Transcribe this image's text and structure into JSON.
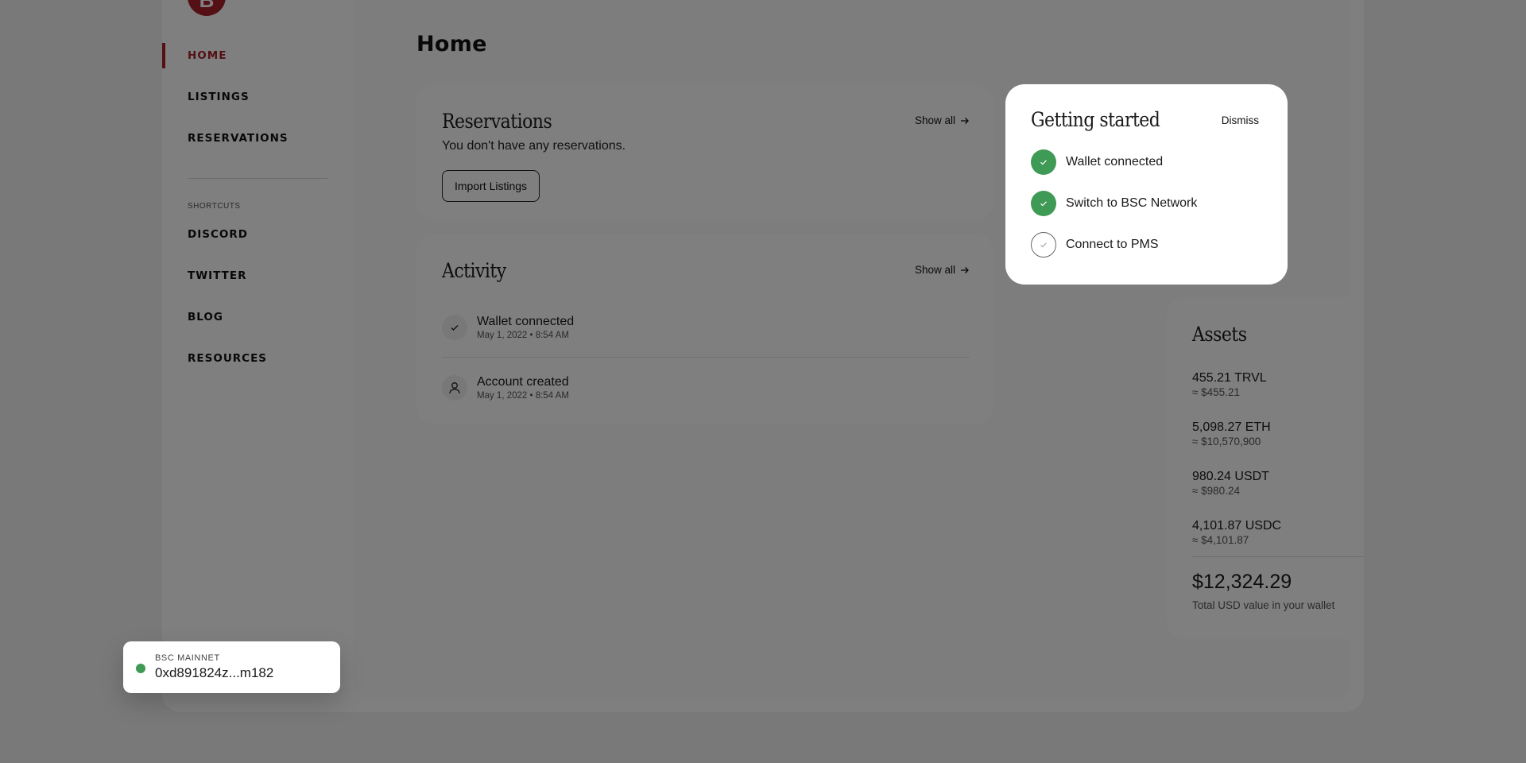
{
  "sidebar": {
    "logo_letter": "B",
    "nav": [
      {
        "label": "HOME",
        "active": true
      },
      {
        "label": "LISTINGS",
        "active": false
      },
      {
        "label": "RESERVATIONS",
        "active": false
      }
    ],
    "shortcuts_label": "SHORTCUTS",
    "shortcuts": [
      {
        "label": "DISCORD"
      },
      {
        "label": "TWITTER"
      },
      {
        "label": "BLOG"
      },
      {
        "label": "RESOURCES"
      }
    ]
  },
  "page": {
    "title": "Home"
  },
  "reservations": {
    "title": "Reservations",
    "show_all": "Show all",
    "empty_text": "You don't have any reservations.",
    "import_button": "Import Listings"
  },
  "activity": {
    "title": "Activity",
    "show_all": "Show all",
    "items": [
      {
        "icon": "check-icon",
        "title": "Wallet connected",
        "time": "May 1, 2022 • 8:54 AM"
      },
      {
        "icon": "user-icon",
        "title": "Account created",
        "time": "May 1, 2022 • 8:54 AM"
      }
    ]
  },
  "getting_started": {
    "title": "Getting started",
    "dismiss": "Dismiss",
    "steps": [
      {
        "label": "Wallet connected",
        "done": true
      },
      {
        "label": "Switch to BSC Network",
        "done": true
      },
      {
        "label": "Connect to PMS",
        "done": false
      }
    ]
  },
  "assets": {
    "title": "Assets",
    "items": [
      {
        "amount": "455.21 TRVL",
        "usd": "≈ $455.21",
        "icon": "trvl-coin-icon",
        "color": "#061621"
      },
      {
        "amount": "5,098.27 ETH",
        "usd": "≈ $10,570,900",
        "icon": "eth-coin-icon",
        "color": "#627eea"
      },
      {
        "amount": "980.24 USDT",
        "usd": "≈ $980.24",
        "icon": "usdt-coin-icon",
        "color": "#26a17b"
      },
      {
        "amount": "4,101.87 USDC",
        "usd": "≈ $4,101.87",
        "icon": "usdc-coin-icon",
        "color": "#2775ca"
      }
    ],
    "total": "$12,324.29",
    "total_label": "Total USD value in your wallet"
  },
  "wallet": {
    "network": "BSC MAINNET",
    "address": "0xd891824z...m182",
    "status_color": "#3f9a55"
  },
  "colors": {
    "brand": "#a8202a",
    "success": "#3f9a55"
  }
}
